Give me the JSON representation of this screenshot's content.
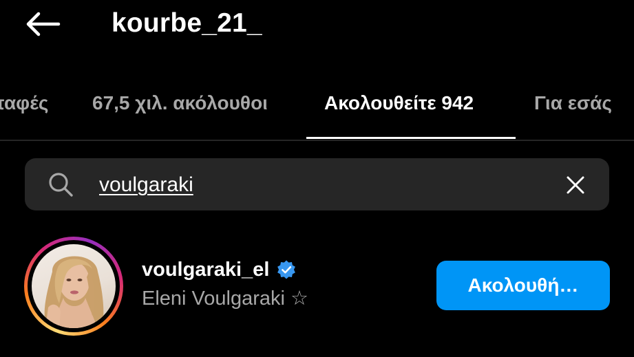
{
  "header": {
    "title": "kourbe_21_",
    "back_icon": "arrow-left-icon"
  },
  "tabs": [
    {
      "label": "επαφές",
      "active": false
    },
    {
      "label": "67,5 χιλ. ακόλουθοι",
      "active": false
    },
    {
      "label": "Ακολουθείτε 942",
      "active": true
    },
    {
      "label": "Για εσάς",
      "active": false
    }
  ],
  "search": {
    "value": "voulgaraki",
    "search_icon": "search-icon",
    "clear_icon": "close-icon"
  },
  "results": [
    {
      "username": "voulgaraki_el",
      "verified": true,
      "full_name": "Eleni Voulgaraki ☆",
      "button_label": "Ακολουθή…",
      "has_story_ring": true
    }
  ],
  "colors": {
    "background": "#000000",
    "primary_text": "#ffffff",
    "secondary_text": "#a8a8a8",
    "search_bg": "#262626",
    "button_blue": "#0095f6",
    "verified_blue": "#3897f0"
  }
}
